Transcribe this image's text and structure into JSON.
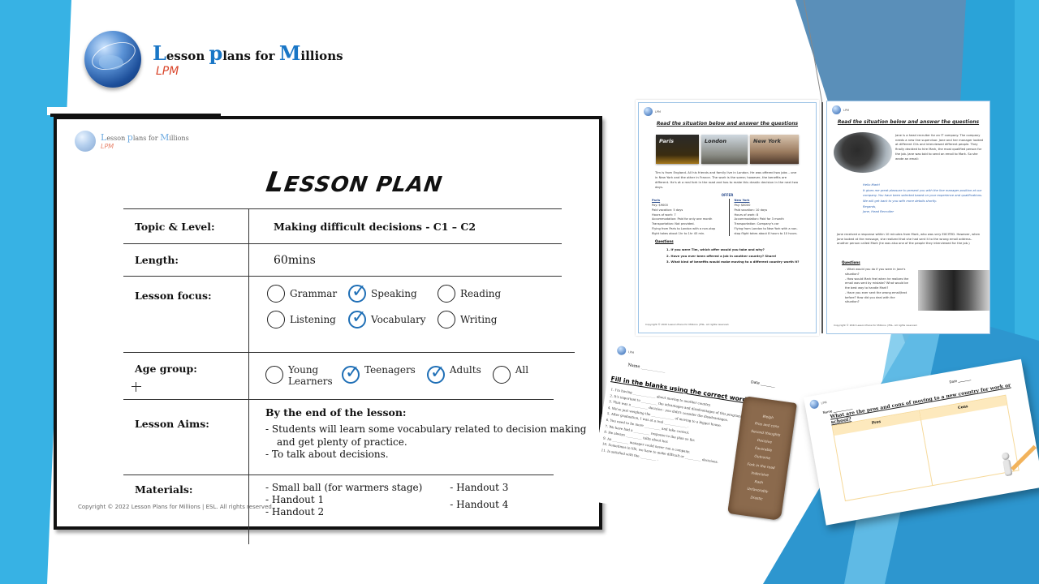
{
  "brand": {
    "title_parts": [
      {
        "cap": "L",
        "rest": "esson "
      },
      {
        "cap": "p",
        "rest": "lans for "
      },
      {
        "cap": "M",
        "rest": "illions"
      }
    ],
    "abbrev": "LPM"
  },
  "lesson_plan": {
    "heading_big": "L",
    "heading_rest": "ESSON PLAN",
    "topic": {
      "label": "Topic & Level:",
      "value": "Making difficult  decisions -  C1 – C2"
    },
    "length": {
      "label": "Length:",
      "value": "60mins"
    },
    "focus": {
      "label": "Lesson focus:",
      "options": [
        {
          "name": "Grammar",
          "checked": false
        },
        {
          "name": "Speaking",
          "checked": true
        },
        {
          "name": "Reading",
          "checked": false
        },
        {
          "name": "Listening",
          "checked": false
        },
        {
          "name": "Vocabulary",
          "checked": true
        },
        {
          "name": "Writing",
          "checked": false
        }
      ]
    },
    "age": {
      "label": "Age group:",
      "options": [
        {
          "name": "Young Learners",
          "checked": false
        },
        {
          "name": "Teenagers",
          "checked": true
        },
        {
          "name": "Adults",
          "checked": true
        },
        {
          "name": "All",
          "checked": false
        }
      ]
    },
    "aims": {
      "label": "Lesson Aims:",
      "intro": "By the end of the lesson:",
      "items": [
        "Students will learn some vocabulary related to decision making and get plenty of practice.",
        "To talk about decisions."
      ]
    },
    "materials": {
      "label": "Materials:",
      "left": [
        "Small ball (for warmers stage)",
        "Handout 1",
        "Handout 2"
      ],
      "right": [
        "Handout 3",
        "Handout 4"
      ]
    },
    "copyright": "Copyright © 2022 Lesson Plans for Millions | ESL.   All rights reserved."
  },
  "handout1": {
    "title": "Read the situation below and answer the questions",
    "cities": [
      "Paris",
      "London",
      "New York"
    ],
    "story": "Tim is from England. All his friends and family live in London. He was offered two jobs – one in New York and the other in France. The work is the same; however, the benefits are different. He's at a real fork in the road and has to make this drastic decision in the next two days.",
    "offer_label": "OFFER",
    "paris": {
      "heading": "Paris",
      "items": [
        "Pay: $9000",
        "Paid vacation: 5 days",
        "Hours of work: 7",
        "Accommodation: Paid for only one month",
        "Transportation: Not provided.",
        "Flying from Paris to London with a non-stop flight takes about 1hr to 1hr 45 min."
      ]
    },
    "newyork": {
      "heading": "New York",
      "items": [
        "Pay: $8000",
        "Paid vacation: 10 days",
        "Hours of work: 8",
        "Accommodation: Paid for 3 month",
        "Transportation: Company's car",
        "Flying from London to New York with a non-stop flight takes about 8 hours to 10 hours."
      ]
    },
    "questions_label": "Questions",
    "questions": [
      "1. If you were Tim, which offer would you take and why?",
      "2. Have you ever been offered a job in another country? Share!",
      "3. What kind of benefits would make moving to a different country worth it?"
    ],
    "copyright": "Copyright © 2022 Lesson Plans for Millions | ESL.   All rights reserved."
  },
  "handout2": {
    "title": "Read the situation below and answer the questions",
    "story": "Jane is a head recruiter for an IT company. The company needs a new line supervisor. Jane and her manager looked at different CVs and interviewed different people. They finally decided to hire Mark, the most qualified person for the job. Jane was told to send an email to Mark. So she wrote an email:",
    "email": [
      "Hello Mark!",
      "It gives me great pleasure to present you with the line manager position at our company. You have been selected based on your experience and qualifications.",
      "We will get back to you with more details shortly.",
      "Regards,",
      "Jane, Head Recruiter"
    ],
    "story2": "Jane received a response within 10 minutes from Mark, who was very EXCITED. However, when Jane looked at the message, she realized that she had sent it to the wrong email address– another person called Mark (he was also one of the people they interviewed for the job.)",
    "questions_label": "Questions",
    "questions": [
      "- What would you do if you were in Jane's situation?",
      "- How would Mark feel when he realizes the email was sent by mistake? What would be the best way to handle Mark?",
      "- Have you ever sent the wrong email/text before? How did you deal with the situation?"
    ],
    "copyright": "Copyright © 2022 Lesson Plans for Millions | ESL.   All rights reserved."
  },
  "handout3": {
    "name_label": "Name ____________",
    "date_label": "Date ________",
    "title": "Fill in the blanks using the correct words.",
    "sentences": [
      "1. I'm having ______________ about moving to another country.",
      "2. It's important to __________ the advantages and disadvantages of this program.",
      "3. That was a __________ decision - you didn't consider the disadvantages.",
      "4. We're just weighing the ______________ of moving to a bigger house.",
      "5. After graduation, I was at a real ______________ .",
      "6. You need to be more __________ and take control.",
      "7. We have had a __________ response to the plan so far.",
      "8. He always __________ talks about her.",
      "9. An __________ manager could never run a company.",
      "10. Sometimes in life, we have to make difficult or __________ decisions.",
      "11. Is satisfied with the __________ ."
    ],
    "word_bank": [
      "Weigh",
      "Pros and cons",
      "Second thoughts",
      "Decisive",
      "Favorable",
      "Outcome",
      "Fork in the road",
      "Indecisive",
      "Rash",
      "Unfavorably",
      "Drastic"
    ]
  },
  "handout4": {
    "name_label": "Name ____________",
    "date_label": "Date ________",
    "title": "What are the pros and cons of moving to a new country for work or school?",
    "columns": [
      "Pros",
      "Cons"
    ]
  }
}
